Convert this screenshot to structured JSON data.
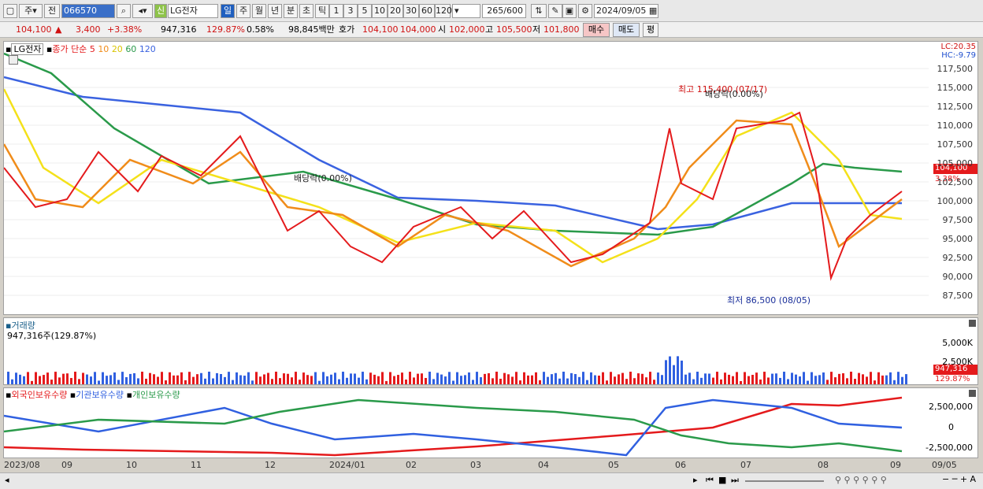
{
  "toolbar": {
    "period_label": "주",
    "type_label": "전",
    "code": "066570",
    "name_badge": "신",
    "name": "LG전자",
    "tabs": [
      "일",
      "주",
      "월",
      "년",
      "분",
      "초",
      "틱"
    ],
    "nums": [
      "1",
      "3",
      "5",
      "10",
      "20",
      "30",
      "60",
      "120"
    ],
    "count": "265",
    "total": "600",
    "date": "2024/09/05"
  },
  "info": {
    "price": "104,100",
    "change": "3,400",
    "pct": "+3.38%",
    "volume": "947,316",
    "vol_ratio": "129.87%",
    "turnover": "0.58%",
    "amount": "98,845백만",
    "ask_label": "호가",
    "ask1": "104,100",
    "ask2": "104,000",
    "open_label": "시",
    "open": "102,000",
    "high_label": "고",
    "high": "105,500",
    "low_label": "저",
    "low": "101,800",
    "buy": "매수",
    "sell": "매도",
    "even": "평"
  },
  "price_panel": {
    "name": "LG전자",
    "legend": "종가 단순",
    "ma": [
      "5",
      "10",
      "20",
      "60",
      "120"
    ],
    "lc": "LC:20.35",
    "hc": "HC:-9.79",
    "yticks": [
      "117,500",
      "115,000",
      "112,500",
      "110,000",
      "107,500",
      "105,000",
      "102,500",
      "100,000",
      "97,500",
      "95,000",
      "92,500",
      "90,000",
      "87,500"
    ],
    "current": "104,100",
    "current_pct": "3.38%",
    "high_note": "최고 115,400 (07/17)",
    "low_note": "최저 86,500 (08/05)",
    "div1": "배당락(0.00%)",
    "div2": "배당락(0.00%)"
  },
  "volume_panel": {
    "title": "거래량",
    "value": "947,316주(129.87%)",
    "yticks": [
      "5,000K",
      "2,500K"
    ],
    "current": "947,316",
    "current_pct": "129.87%"
  },
  "holding_panel": {
    "s1": "외국인보유수량",
    "s2": "기관보유수량",
    "s3": "개인보유수량",
    "yticks": [
      "2,500,000",
      "0",
      "-2,500,000"
    ]
  },
  "xaxis": [
    "2023/08",
    "09",
    "10",
    "11",
    "12",
    "2024/01",
    "02",
    "03",
    "04",
    "05",
    "06",
    "07",
    "08",
    "09",
    "09/05"
  ],
  "colors": {
    "red": "#e41a1c",
    "blue": "#3060e0",
    "green": "#2a9a4a",
    "yellow": "#f4e11a",
    "orange": "#f08c1a",
    "ma120": "#3a62e0"
  }
}
